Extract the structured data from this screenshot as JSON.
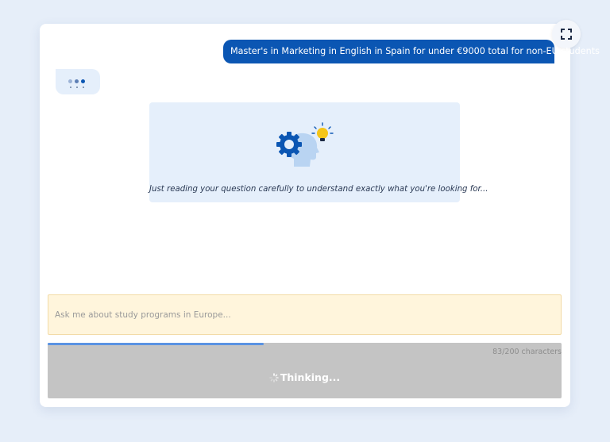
{
  "chat": {
    "user_message": "Master's in Marketing in English in Spain for under €9000 total for non-EU students",
    "thinking_text": "Just reading your question carefully to understand exactly what you're looking for...",
    "typing_indicator_icon": "typing-dots-icon",
    "thinking_icons": [
      "gear-icon",
      "head-icon",
      "lightbulb-icon"
    ]
  },
  "input": {
    "placeholder": "Ask me about study programs in Europe...",
    "value": "",
    "char_count": "83/200 characters"
  },
  "submit": {
    "label": "Thinking...",
    "state": "loading",
    "progress": 0.42
  },
  "toolbar": {
    "expand_icon": "expand-icon"
  },
  "colors": {
    "background": "#e6eef9",
    "user_bubble": "#0b56b3",
    "panel": "#e5effb",
    "input_bg": "#fff5dc",
    "button_disabled": "#c4c4c4",
    "progress": "#5a93e3",
    "gear": "#0b56b3",
    "head": "#b9d4f2",
    "bulb": "#f5c518"
  }
}
